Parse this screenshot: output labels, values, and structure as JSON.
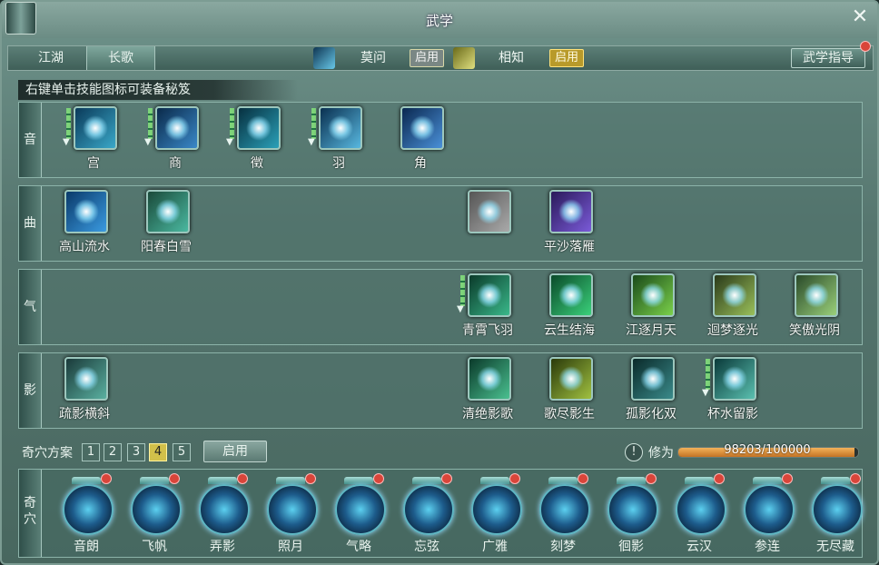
{
  "window": {
    "title": "武学"
  },
  "tabs": [
    {
      "label": "江湖"
    },
    {
      "label": "长歌"
    }
  ],
  "school": {
    "sect1": {
      "name": "莫问",
      "badge": "启用"
    },
    "sect2": {
      "name": "相知",
      "badge": "启用"
    },
    "guide_button": "武学指导"
  },
  "hint": "右键单击技能图标可装备秘笈",
  "rows": [
    {
      "cap": "音",
      "skills": [
        "宫",
        "商",
        "徵",
        "羽",
        "角"
      ]
    },
    {
      "cap": "曲",
      "skills": [
        "高山流水",
        "阳春白雪",
        "平沙落雁"
      ]
    },
    {
      "cap": "气",
      "skills": [
        "青霄飞羽",
        "云生结海",
        "江逐月天",
        "迴梦逐光",
        "笑傲光阴"
      ]
    },
    {
      "cap": "影",
      "skills": [
        "疏影横斜",
        "清绝影歌",
        "歌尽影生",
        "孤影化双",
        "杯水留影"
      ]
    }
  ],
  "schemes": {
    "label": "奇穴方案",
    "numbers": [
      "1",
      "2",
      "3",
      "4",
      "5"
    ],
    "selected": "4",
    "enable_button": "启用"
  },
  "cultivation": {
    "label": "修为",
    "value": 98203,
    "max": 100000,
    "text": "98203/100000"
  },
  "qixue": {
    "cap": "奇穴",
    "items": [
      "音朗",
      "飞帆",
      "弄影",
      "照月",
      "气略",
      "忘弦",
      "广雅",
      "刻梦",
      "徊影",
      "云汉",
      "参连",
      "无尽藏"
    ]
  }
}
